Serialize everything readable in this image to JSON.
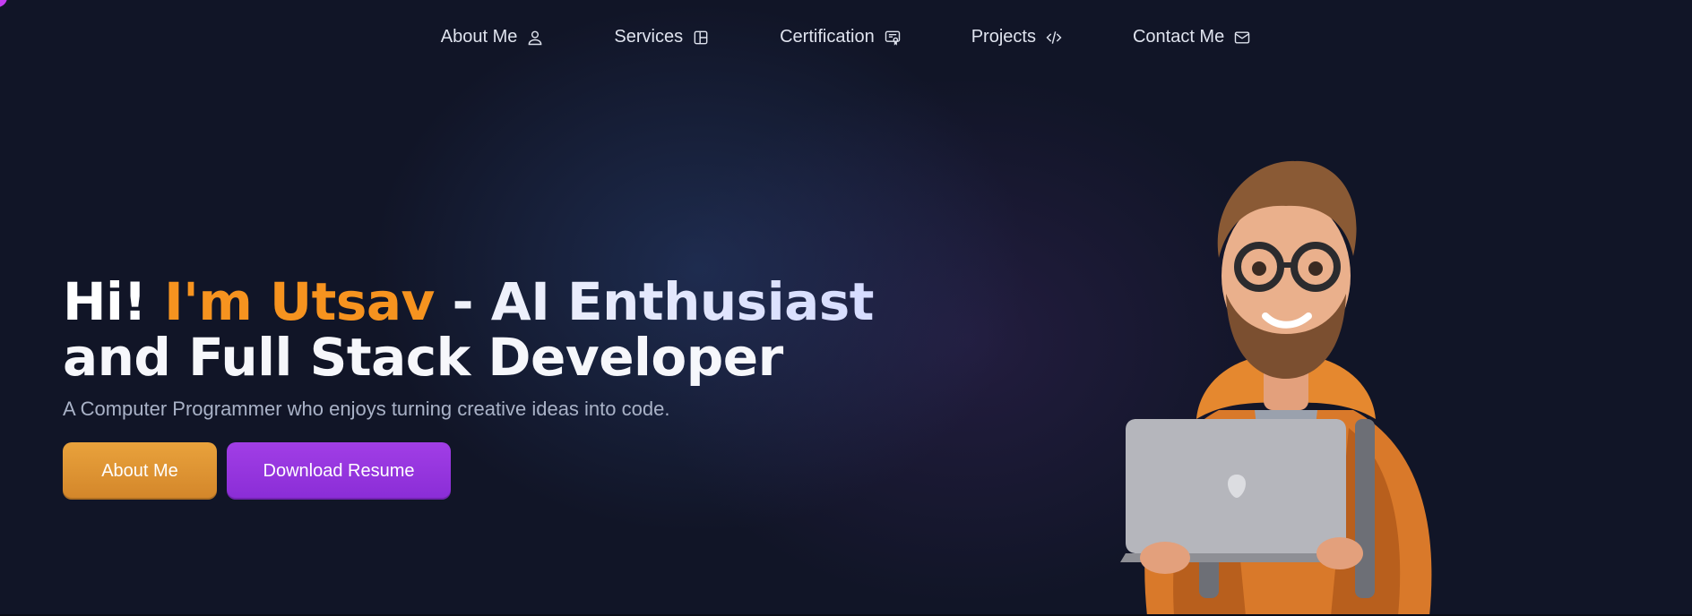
{
  "nav": {
    "items": [
      {
        "label": "About Me",
        "icon": "user-icon"
      },
      {
        "label": "Services",
        "icon": "layout-icon"
      },
      {
        "label": "Certification",
        "icon": "certificate-icon"
      },
      {
        "label": "Projects",
        "icon": "code-icon"
      },
      {
        "label": "Contact Me",
        "icon": "mail-icon"
      }
    ]
  },
  "hero": {
    "greeting": "Hi! ",
    "name": "I'm Utsav",
    "title_rest_line1": " - AI Enthusiast",
    "title_line2": "and Full Stack Developer",
    "subtitle": "A Computer Programmer who enjoys turning creative ideas into code.",
    "buttons": {
      "about": "About Me",
      "resume": "Download Resume"
    }
  },
  "colors": {
    "background": "#111527",
    "accent_orange": "#f6931f",
    "button_orange": "#e09534",
    "button_purple": "#9a39e0"
  },
  "avatar": {
    "icon": "developer-avatar-illustration"
  }
}
